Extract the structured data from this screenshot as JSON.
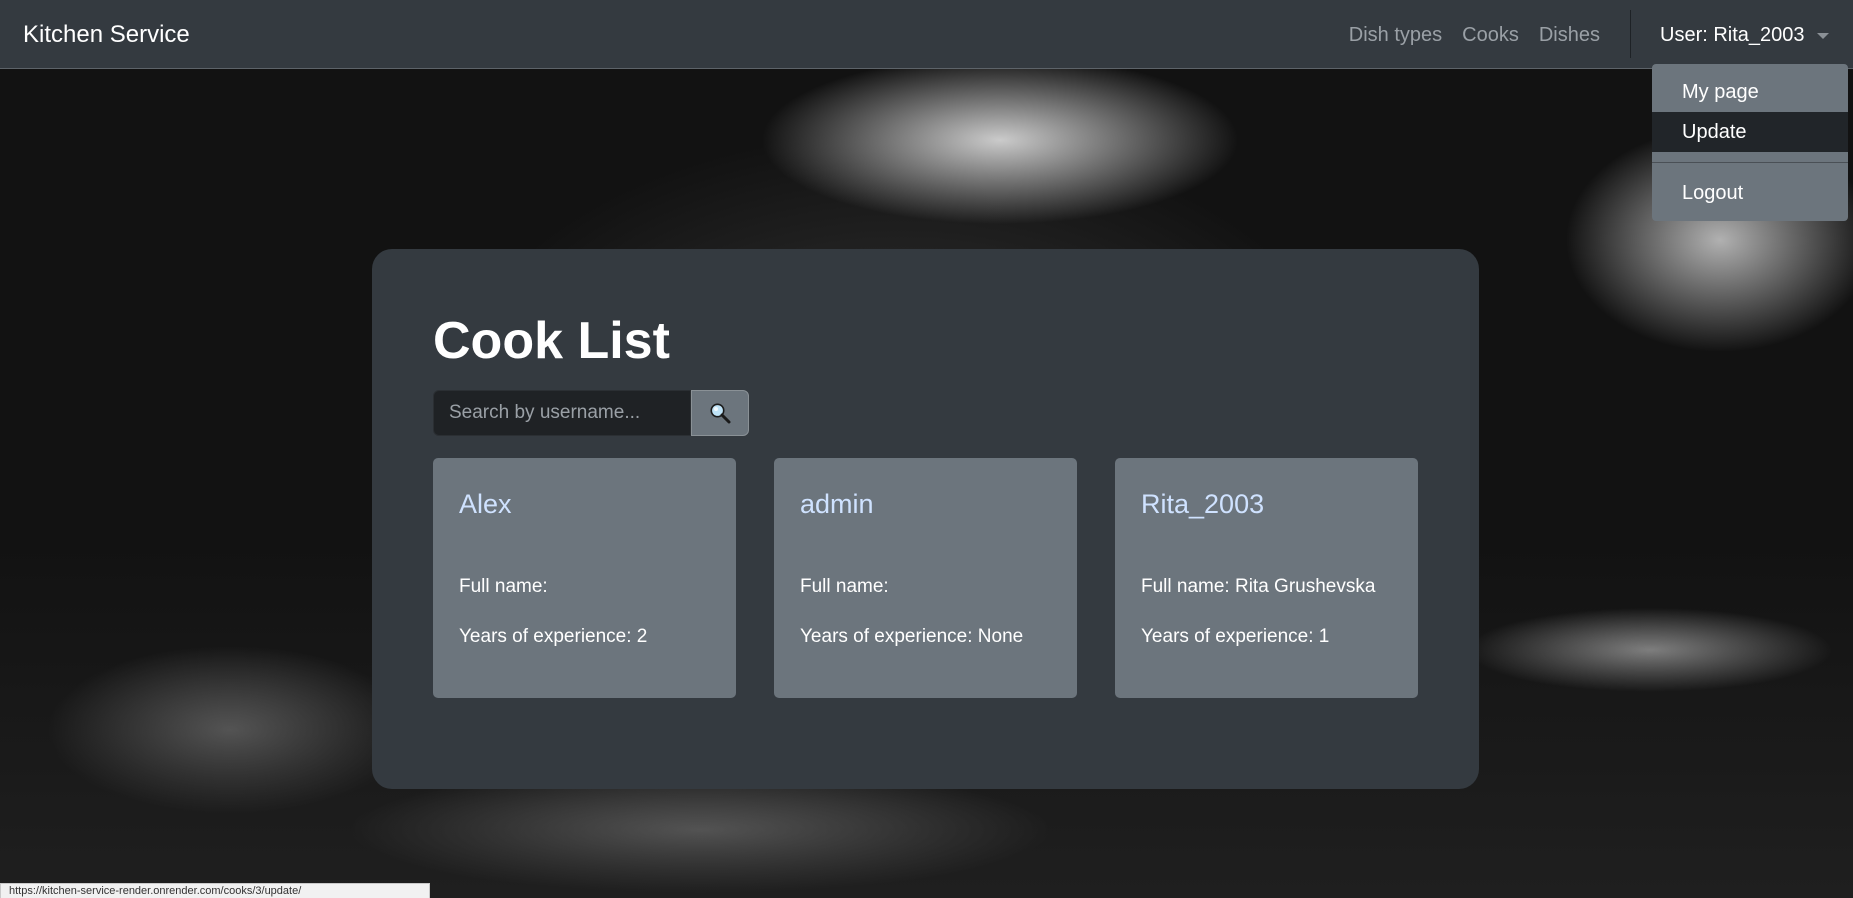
{
  "navbar": {
    "brand": "Kitchen Service",
    "links": [
      {
        "label": "Dish types"
      },
      {
        "label": "Cooks"
      },
      {
        "label": "Dishes"
      }
    ],
    "user_label": "User: Rita_2003"
  },
  "dropdown": {
    "items": [
      {
        "label": "My page"
      },
      {
        "label": "Update"
      },
      {
        "label": "Logout"
      }
    ],
    "active_item": "Update"
  },
  "main": {
    "title": "Cook List",
    "search": {
      "placeholder": "Search by username...",
      "value": "",
      "button_icon": "magnifier-icon"
    },
    "cooks": [
      {
        "username": "Alex",
        "full_name": "Full name:",
        "experience": "Years of experience: 2"
      },
      {
        "username": "admin",
        "full_name": "Full name:",
        "experience": "Years of experience: None"
      },
      {
        "username": "Rita_2003",
        "full_name": "Full name: Rita Grushevska",
        "experience": "Years of experience: 1"
      }
    ]
  },
  "status_url": "https://kitchen-service-render.onrender.com/cooks/3/update/",
  "colors": {
    "navbar_bg": "#343a40",
    "panel_bg": "#343a40",
    "card_bg": "#6c757d",
    "card_title": "#cfe2ff",
    "dropdown_active": "#212529"
  }
}
